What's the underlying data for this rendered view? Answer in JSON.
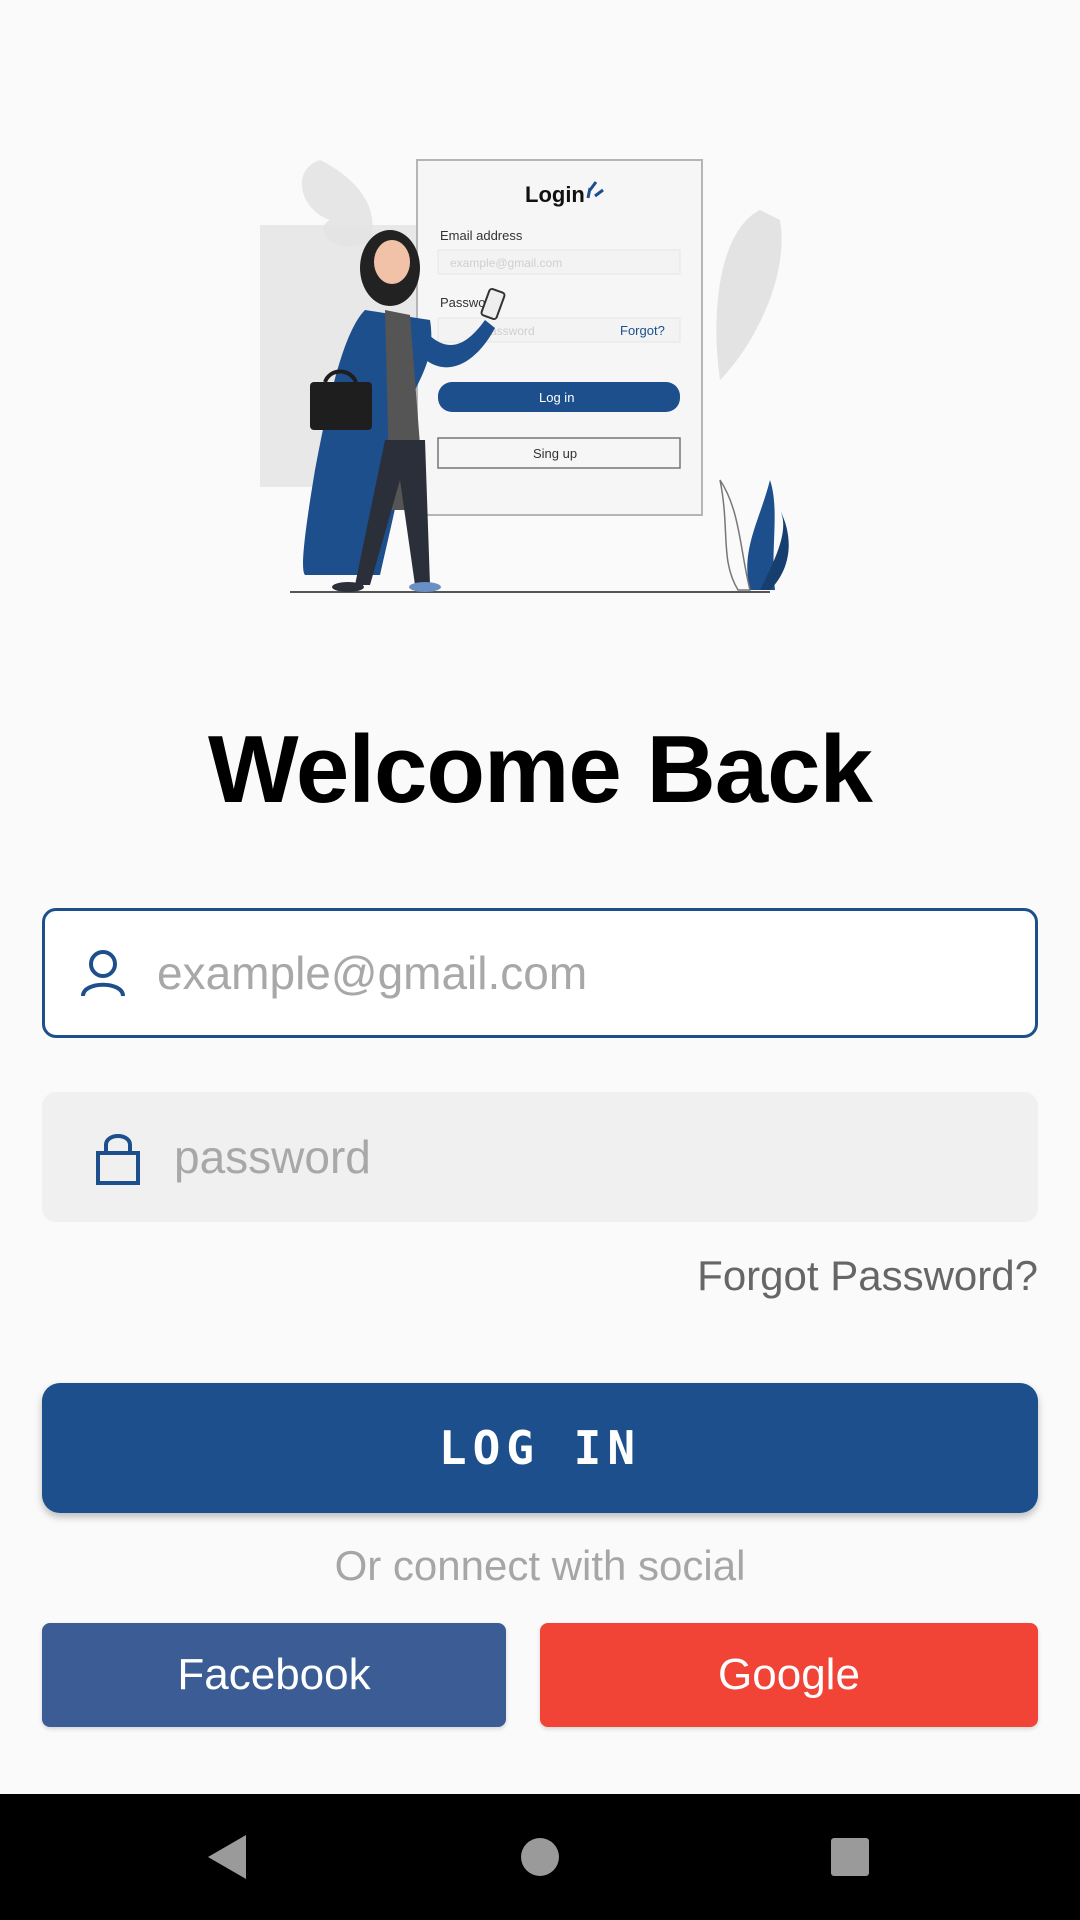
{
  "illustration": {
    "card_title": "Login",
    "email_label": "Email address",
    "email_placeholder": "example@gmail.com",
    "password_label": "Passwo",
    "password_placeholder": "Password",
    "forgot_link": "Forgot?",
    "login_button": "Log in",
    "signup_button": "Sing up"
  },
  "title": "Welcome Back",
  "email_field": {
    "icon": "user-icon",
    "placeholder": "example@gmail.com",
    "value": ""
  },
  "password_field": {
    "icon": "lock-icon",
    "placeholder": "password",
    "value": ""
  },
  "forgot_password": "Forgot Password?",
  "login_button": "LOG IN",
  "connect_text": "Or connect with social",
  "social": {
    "facebook_label": "Facebook",
    "google_label": "Google"
  },
  "colors": {
    "primary": "#1c4f8c",
    "facebook": "#3b5c94",
    "google": "#f14437",
    "background": "#fafafa"
  },
  "navbar": {
    "back_icon": "back-triangle-icon",
    "home_icon": "home-circle-icon",
    "recents_icon": "recents-square-icon"
  }
}
